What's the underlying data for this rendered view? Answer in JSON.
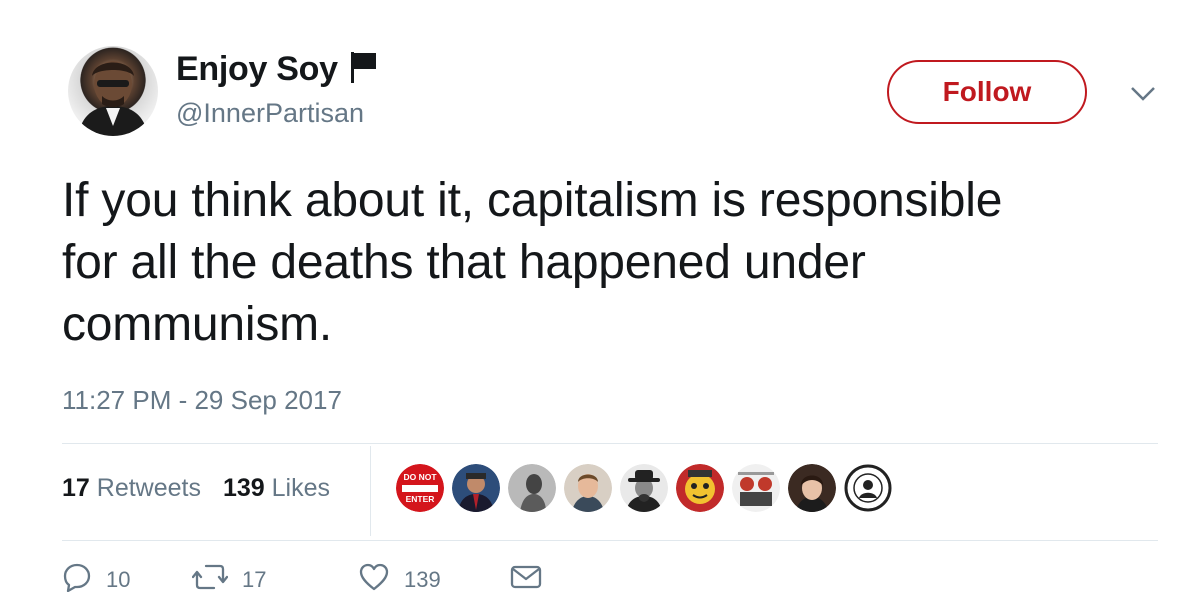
{
  "author": {
    "display_name": "Enjoy Soy",
    "handle": "@InnerPartisan"
  },
  "follow_button": {
    "label": "Follow"
  },
  "tweet": {
    "line1": "If you think about it, capitalism is responsible",
    "line2": "for all the deaths that happened under",
    "line3": "communism.",
    "timestamp": "11:27 PM - 29 Sep 2017"
  },
  "stats": {
    "retweets_count": "17",
    "retweets_label": "Retweets",
    "likes_count": "139",
    "likes_label": "Likes"
  },
  "likers": [
    {
      "icon": "do-not-enter-avatar",
      "text_top": "DO NOT",
      "text_bottom": "ENTER"
    },
    {
      "icon": "person-avatar"
    },
    {
      "icon": "person-avatar"
    },
    {
      "icon": "person-avatar"
    },
    {
      "icon": "cowboy-avatar"
    },
    {
      "icon": "cartoon-avatar"
    },
    {
      "icon": "group-avatar"
    },
    {
      "icon": "person-avatar"
    },
    {
      "icon": "circular-logo-avatar"
    }
  ],
  "actions": {
    "reply_count": "10",
    "retweet_count": "17",
    "like_count": "139"
  },
  "colors": {
    "follow_red": "#c0191f",
    "secondary_text": "#657786",
    "divider": "#e1e8ed"
  }
}
